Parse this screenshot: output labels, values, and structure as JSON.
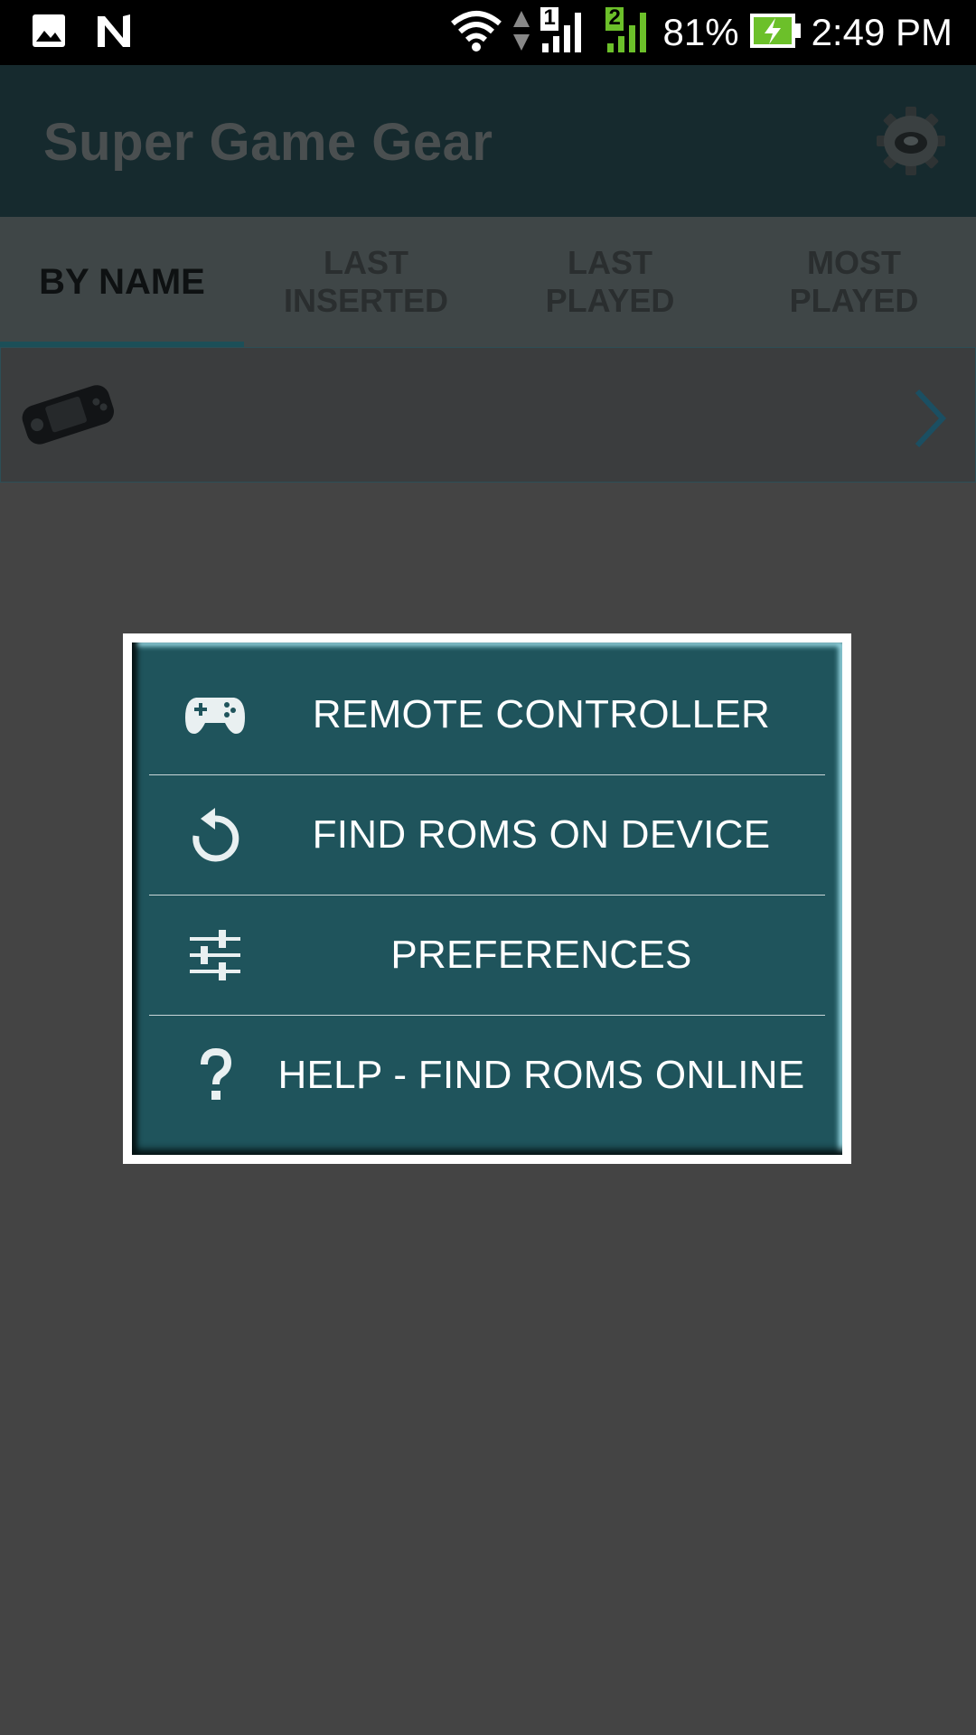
{
  "status_bar": {
    "sim1_label": "1",
    "sim2_label": "2",
    "battery_percent": "81%",
    "time": "2:49 PM",
    "icons": [
      "gallery-icon",
      "n-icon",
      "wifi-icon",
      "data-arrows-icon",
      "signal-icon",
      "battery-charging-icon"
    ],
    "colors": {
      "sim2": "#6cc02a",
      "battery_fill": "#6cc02a"
    }
  },
  "app_bar": {
    "title": "Super Game Gear",
    "settings_icon": "gear-icon"
  },
  "tabs": [
    {
      "label": "BY NAME",
      "active": true
    },
    {
      "label": "LAST\nINSERTED",
      "active": false
    },
    {
      "label": "LAST\nPLAYED",
      "active": false
    },
    {
      "label": "MOST\nPLAYED",
      "active": false
    }
  ],
  "list": {
    "rows": [
      {
        "thumbnail_icon": "game-gear-console-icon",
        "chevron_icon": "chevron-right-icon"
      }
    ]
  },
  "menu": {
    "items": [
      {
        "label": "REMOTE CONTROLLER",
        "icon": "gamepad-icon"
      },
      {
        "label": "FIND ROMS ON DEVICE",
        "icon": "refresh-icon"
      },
      {
        "label": "PREFERENCES",
        "icon": "sliders-icon"
      },
      {
        "label": "HELP - FIND ROMS ONLINE",
        "icon": "question-icon"
      }
    ],
    "colors": {
      "background": "#1f545c",
      "frame": "#ffffff"
    }
  }
}
